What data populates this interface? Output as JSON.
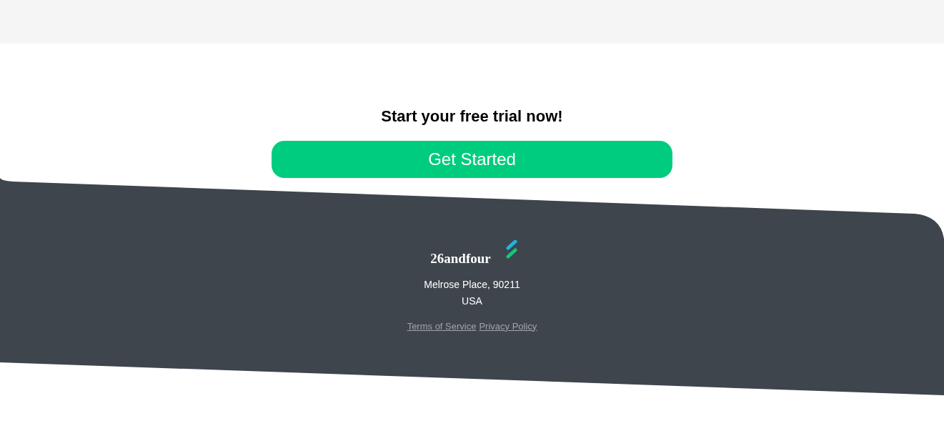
{
  "cta": {
    "heading": "Start your free trial now!",
    "button": "Get Started"
  },
  "footer": {
    "brand": "26andfour",
    "address": [
      "Melrose Place, 90211",
      "USA"
    ],
    "links": [
      "Terms of Service",
      "Privacy Policy"
    ]
  }
}
